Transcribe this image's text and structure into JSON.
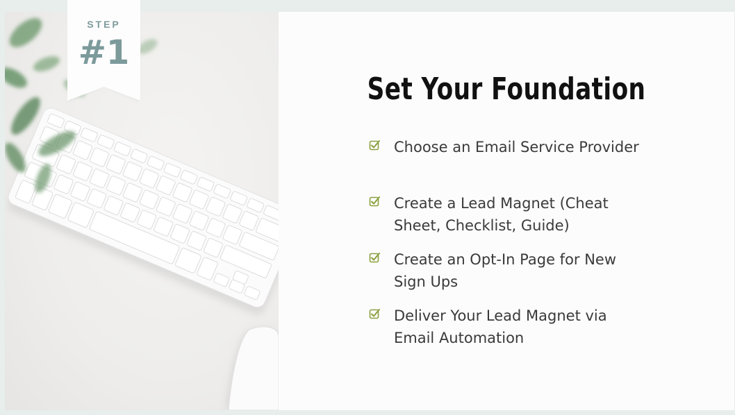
{
  "badge": {
    "step_label": "STEP",
    "number": "#1"
  },
  "title": "Set Your Foundation",
  "checklist": [
    {
      "text": "Choose an Email Service Provider"
    },
    {
      "text": "Create a Lead Magnet (Cheat Sheet, Checklist, Guide)"
    },
    {
      "text": "Create an Opt-In Page for New Sign Ups"
    },
    {
      "text": "Deliver Your Lead Magnet via Email Automation"
    }
  ],
  "colors": {
    "background": "#e7eeec",
    "badge_text": "#7d9a9b",
    "check_icon": "#8aa03f",
    "title": "#111111",
    "body_text": "#3a3a3a"
  },
  "icons": {
    "check": "checkbox-check-icon"
  }
}
